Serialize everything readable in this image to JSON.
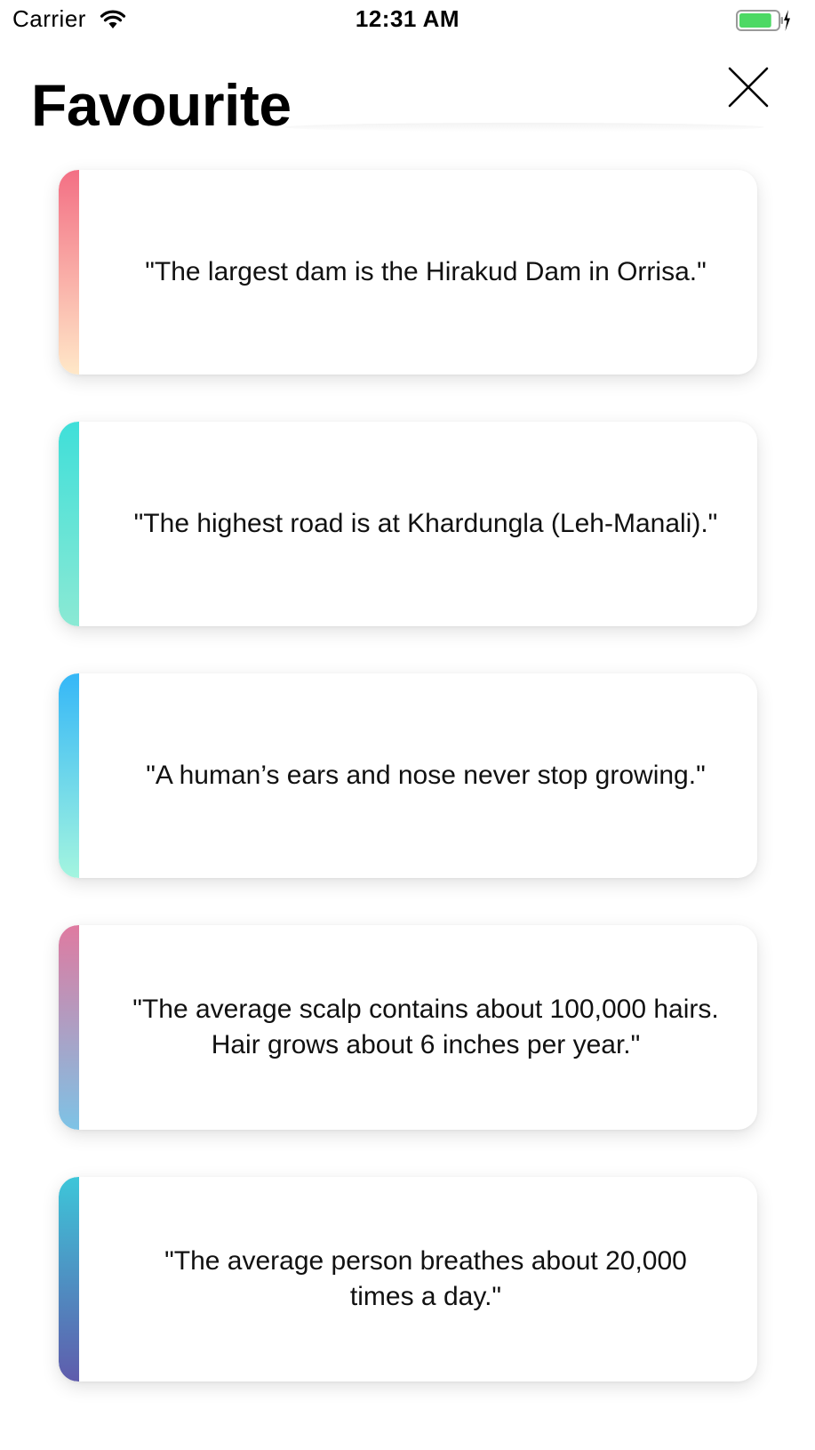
{
  "status_bar": {
    "carrier": "Carrier",
    "time": "12:31 AM",
    "wifi_icon": "wifi-icon",
    "battery_icon": "battery-charging-icon",
    "battery_level": 0.85,
    "battery_color": "#4cd964"
  },
  "header": {
    "title": "Favourite",
    "close_icon": "close-icon"
  },
  "cards": [
    {
      "text": "\"The largest dam is the Hirakud Dam in Orrisa.\"",
      "accent_top": "#f36f84",
      "accent_bottom": "#ffe8c8"
    },
    {
      "text": "\"The highest road is at Khardungla (Leh-Manali).\"",
      "accent_top": "#3fdfd9",
      "accent_bottom": "#8be9d4"
    },
    {
      "text": "\"A human’s ears and nose never stop growing.\"",
      "accent_top": "#35b7f7",
      "accent_bottom": "#a4f5df"
    },
    {
      "text": "\"The average scalp contains about 100,000 hairs. Hair grows about 6 inches per year.\"",
      "accent_top": "#df7aa0",
      "accent_bottom": "#7dc3e6"
    },
    {
      "text": "\"The average person breathes about 20,000 times a day.\"",
      "accent_top": "#3dc6d9",
      "accent_bottom": "#5f5cac"
    }
  ]
}
